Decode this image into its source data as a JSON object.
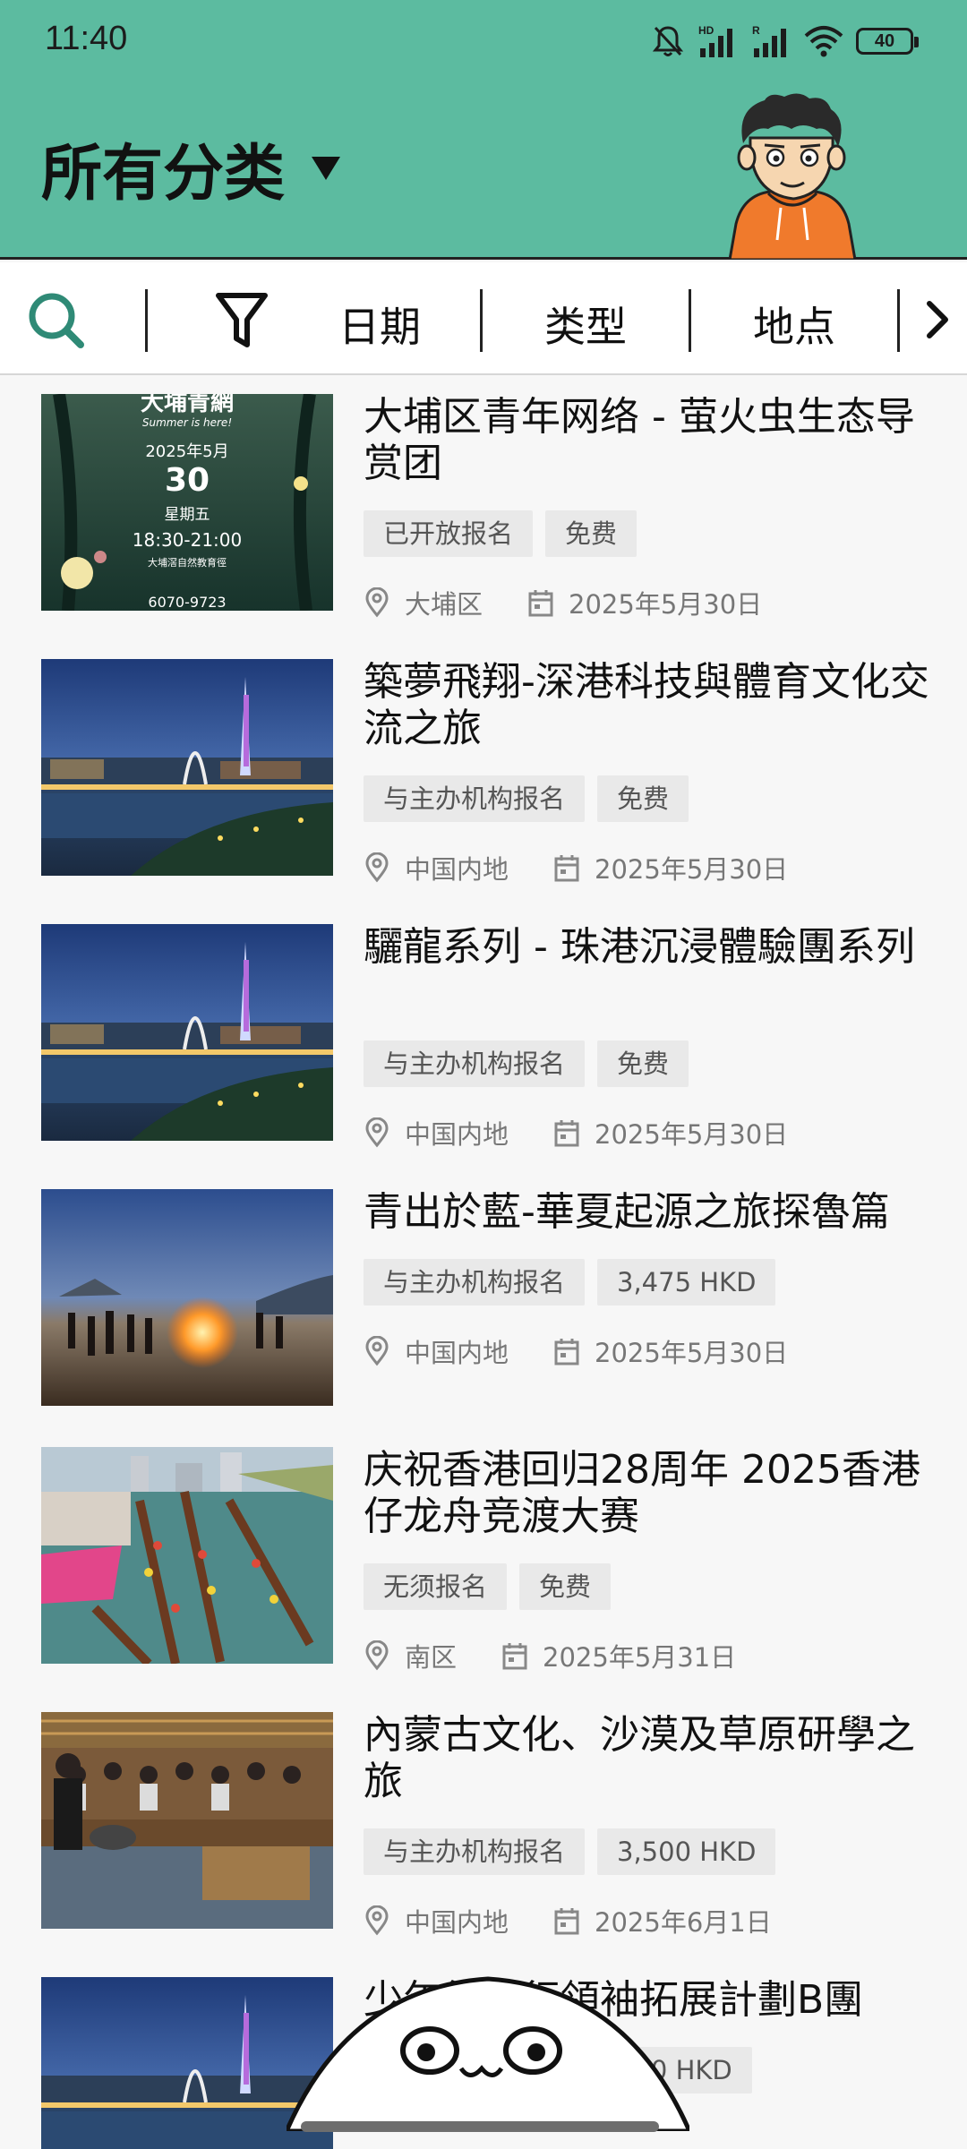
{
  "status_bar": {
    "time": "11:40",
    "battery": "40",
    "icons": [
      "mute-bell-icon",
      "hd-signal-icon",
      "r-signal-icon",
      "wifi-icon",
      "battery-icon"
    ]
  },
  "header": {
    "title": "所有分类",
    "dropdown_icon": "caret-down-icon",
    "mascot": "boy-orange-hoodie-avatar"
  },
  "filters": {
    "search_icon": "search-icon",
    "filter_icon": "funnel-icon",
    "date_label": "日期",
    "type_label": "类型",
    "location_label": "地点",
    "more_icon": "chevron-right-icon"
  },
  "thumb_texts": {
    "title": "大埔青網",
    "subtitle": "Summer is here!",
    "date": "2025年5月",
    "day": "30",
    "weekday": "星期五",
    "time": "18:30-21:00",
    "venue": "大埔滘自然教育徑",
    "phone": "6070-9723"
  },
  "events": [
    {
      "title": "大埔区青年网络 - 萤火虫生态导赏团",
      "tags": [
        "已开放报名",
        "免费"
      ],
      "location": "大埔区",
      "date": "2025年5月30日",
      "image": "firefly-poster"
    },
    {
      "title": "築夢飛翔-深港科技與體育文化交流之旅",
      "tags": [
        "与主办机构报名",
        "免费"
      ],
      "location": "中国内地",
      "date": "2025年5月30日",
      "image": "canton-tower-night"
    },
    {
      "title": "驪龍系列 - 珠港沉浸體驗團系列",
      "tags": [
        "与主办机构报名",
        "免费"
      ],
      "location": "中国内地",
      "date": "2025年5月30日",
      "image": "canton-tower-night"
    },
    {
      "title": "青出於藍-華夏起源之旅探魯篇",
      "tags": [
        "与主办机构报名",
        "3,475 HKD"
      ],
      "location": "中国内地",
      "date": "2025年5月30日",
      "image": "bonfire-dance"
    },
    {
      "title": "庆祝香港回归28周年 2025香港仔龙舟竞渡大赛",
      "tags": [
        "无须报名",
        "免费"
      ],
      "location": "南区",
      "date": "2025年5月31日",
      "image": "dragon-boat-race"
    },
    {
      "title": "內蒙古文化、沙漠及草原研學之旅",
      "tags": [
        "与主办机构报名",
        "3,500 HKD"
      ],
      "location": "中国内地",
      "date": "2025年6月1日",
      "image": "yurt-gathering"
    },
    {
      "title": "少年從軍行領袖拓展計劃B團",
      "tags": [
        "",
        "200 HKD"
      ],
      "location": "",
      "date": "",
      "image": "canton-tower-night"
    }
  ]
}
